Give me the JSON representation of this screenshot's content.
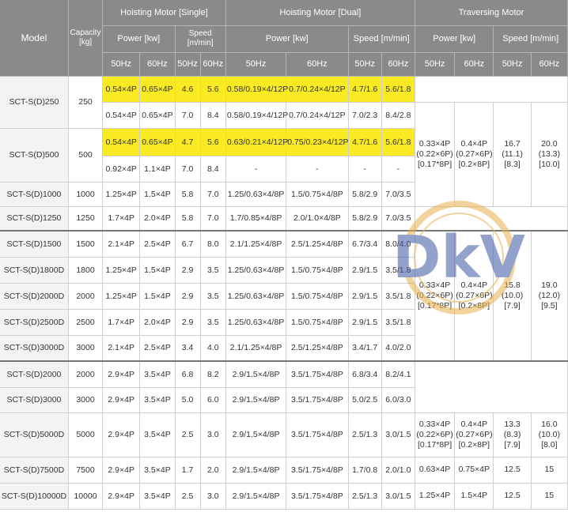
{
  "header": {
    "model": "Model",
    "capacity": "Capacity [kg]",
    "hoist_single": "Hoisting Motor [Single]",
    "hoist_dual": "Hoisting Motor [Dual]",
    "traversing": "Traversing Motor",
    "power": "Power [kw]",
    "speed_single": "Speed [m/min]",
    "speed": "Speed [m/min]",
    "hz50": "50Hz",
    "hz60": "60Hz"
  },
  "rows": [
    {
      "model": "SCT-S(D)250",
      "cap": "250",
      "sp50": "0.54×4P",
      "sp60": "0.65×4P",
      "ss50": "4.6",
      "ss60": "5.6",
      "dp50": "0.58/0.19×4/12P",
      "dp60": "0.7/0.24×4/12P",
      "ds50": "4.7/1.6",
      "ds60": "5.6/1.8"
    },
    {
      "model": "",
      "cap": "",
      "sp50": "0.54×4P",
      "sp60": "0.65×4P",
      "ss50": "7.0",
      "ss60": "8.4",
      "dp50": "0.58/0.19×4/12P",
      "dp60": "0.7/0.24×4/12P",
      "ds50": "7.0/2.3",
      "ds60": "8.4/2.8"
    },
    {
      "model": "SCT-S(D)500",
      "cap": "500",
      "sp50": "0.54×4P",
      "sp60": "0.65×4P",
      "ss50": "4.7",
      "ss60": "5.6",
      "dp50": "0.63/0.21×4/12P",
      "dp60": "0.75/0.23×4/12P",
      "ds50": "4.7/1.6",
      "ds60": "5.6/1.8"
    },
    {
      "model": "",
      "cap": "",
      "sp50": "0.92×4P",
      "sp60": "1.1×4P",
      "ss50": "7.0",
      "ss60": "8.4",
      "dp50": "-",
      "dp60": "-",
      "ds50": "-",
      "ds60": "-"
    },
    {
      "model": "SCT-S(D)1000",
      "cap": "1000",
      "sp50": "1.25×4P",
      "sp60": "1.5×4P",
      "ss50": "5.8",
      "ss60": "7.0",
      "dp50": "1.25/0.63×4/8P",
      "dp60": "1.5/0.75×4/8P",
      "ds50": "5.8/2.9",
      "ds60": "7.0/3.5"
    },
    {
      "model": "SCT-S(D)1250",
      "cap": "1250",
      "sp50": "1.7×4P",
      "sp60": "2.0×4P",
      "ss50": "5.8",
      "ss60": "7.0",
      "dp50": "1.7/0.85×4/8P",
      "dp60": "2.0/1.0×4/8P",
      "ds50": "5.8/2.9",
      "ds60": "7.0/3.5"
    },
    {
      "model": "SCT-S(D)1500",
      "cap": "1500",
      "sp50": "2.1×4P",
      "sp60": "2.5×4P",
      "ss50": "6.7",
      "ss60": "8.0",
      "dp50": "2.1/1.25×4/8P",
      "dp60": "2.5/1.25×4/8P",
      "ds50": "6.7/3.4",
      "ds60": "8.0/4.0"
    },
    {
      "model": "SCT-S(D)1800D",
      "cap": "1800",
      "sp50": "1.25×4P",
      "sp60": "1.5×4P",
      "ss50": "2.9",
      "ss60": "3.5",
      "dp50": "1.25/0.63×4/8P",
      "dp60": "1.5/0.75×4/8P",
      "ds50": "2.9/1.5",
      "ds60": "3.5/1.8"
    },
    {
      "model": "SCT-S(D)2000D",
      "cap": "2000",
      "sp50": "1.25×4P",
      "sp60": "1.5×4P",
      "ss50": "2.9",
      "ss60": "3.5",
      "dp50": "1.25/0.63×4/8P",
      "dp60": "1.5/0.75×4/8P",
      "ds50": "2.9/1.5",
      "ds60": "3.5/1.8"
    },
    {
      "model": "SCT-S(D)2500D",
      "cap": "2500",
      "sp50": "1.7×4P",
      "sp60": "2.0×4P",
      "ss50": "2.9",
      "ss60": "3.5",
      "dp50": "1.25/0.63×4/8P",
      "dp60": "1.5/0.75×4/8P",
      "ds50": "2.9/1.5",
      "ds60": "3.5/1.8"
    },
    {
      "model": "SCT-S(D)3000D",
      "cap": "3000",
      "sp50": "2.1×4P",
      "sp60": "2.5×4P",
      "ss50": "3.4",
      "ss60": "4.0",
      "dp50": "2.1/1.25×4/8P",
      "dp60": "2.5/1.25×4/8P",
      "ds50": "3.4/1.7",
      "ds60": "4.0/2.0"
    },
    {
      "model": "SCT-S(D)2000",
      "cap": "2000",
      "sp50": "2.9×4P",
      "sp60": "3.5×4P",
      "ss50": "6.8",
      "ss60": "8.2",
      "dp50": "2.9/1.5×4/8P",
      "dp60": "3.5/1.75×4/8P",
      "ds50": "6.8/3.4",
      "ds60": "8.2/4.1"
    },
    {
      "model": "SCT-S(D)3000",
      "cap": "3000",
      "sp50": "2.9×4P",
      "sp60": "3.5×4P",
      "ss50": "5.0",
      "ss60": "6.0",
      "dp50": "2.9/1.5×4/8P",
      "dp60": "3.5/1.75×4/8P",
      "ds50": "5.0/2.5",
      "ds60": "6.0/3.0"
    },
    {
      "model": "SCT-S(D)5000D",
      "cap": "5000",
      "sp50": "2.9×4P",
      "sp60": "3.5×4P",
      "ss50": "2.5",
      "ss60": "3.0",
      "dp50": "2.9/1.5×4/8P",
      "dp60": "3.5/1.75×4/8P",
      "ds50": "2.5/1.3",
      "ds60": "3.0/1.5"
    },
    {
      "model": "SCT-S(D)7500D",
      "cap": "7500",
      "sp50": "2.9×4P",
      "sp60": "3.5×4P",
      "ss50": "1.7",
      "ss60": "2.0",
      "dp50": "2.9/1.5×4/8P",
      "dp60": "3.5/1.75×4/8P",
      "ds50": "1.7/0.8",
      "ds60": "2.0/1.0"
    },
    {
      "model": "SCT-S(D)10000D",
      "cap": "10000",
      "sp50": "2.9×4P",
      "sp60": "3.5×4P",
      "ss50": "2.5",
      "ss60": "3.0",
      "dp50": "2.9/1.5×4/8P",
      "dp60": "3.5/1.75×4/8P",
      "ds50": "2.5/1.3",
      "ds60": "3.0/1.5"
    }
  ],
  "trav": {
    "a": {
      "p50": [
        "0.33×4P",
        "(0.22×6P)",
        "[0.17*8P]"
      ],
      "p60": [
        "0.4×4P",
        "(0.27×6P)",
        "[0.2×8P]"
      ],
      "s50": [
        "16.7",
        "(11.1)",
        "[8.3]"
      ],
      "s60": [
        "20.0",
        "(13.3)",
        "[10.0]"
      ]
    },
    "b": {
      "p50": [
        "0.33×4P",
        "(0.22×6P)",
        "[0.17*8P]"
      ],
      "p60": [
        "0.4×4P",
        "(0.27×6P)",
        "[0.2×8P]"
      ],
      "s50": [
        "15.8",
        "(10.0)",
        "[7.9]"
      ],
      "s60": [
        "19.0",
        "(12.0)",
        "[9.5]"
      ]
    },
    "c": {
      "p50": [
        "0.33×4P",
        "(0.22×6P)",
        "[0.17*8P]"
      ],
      "p60": [
        "0.4×4P",
        "(0.27×6P)",
        "[0.2×8P]"
      ],
      "s50": [
        "13.3",
        "(8.3)",
        "[7.9]"
      ],
      "s60": [
        "16.0",
        "(10.0)",
        "[8.0]"
      ]
    },
    "d": {
      "p50": "0.63×4P",
      "p60": "0.75×4P",
      "s50": "12.5",
      "s60": "15"
    },
    "e": {
      "p50": "1.25×4P",
      "p60": "1.5×4P",
      "s50": "12.5",
      "s60": "15"
    }
  },
  "highlight_rows": [
    0,
    2
  ],
  "colors": {
    "header_bg": "#8a8a8a",
    "highlight": "#f9ea24",
    "model_bg": "#f3f3f3",
    "logo_blue": "#3b56a6",
    "logo_orange": "#e7b04a"
  },
  "logo": {
    "text": "DkV"
  }
}
